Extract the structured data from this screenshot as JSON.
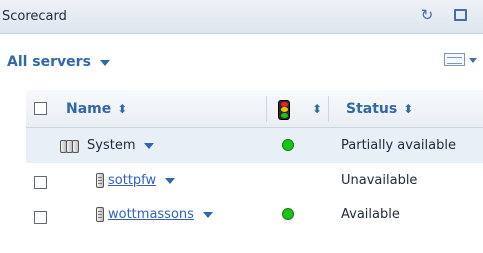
{
  "panel": {
    "title": "Scorecard",
    "icons": [
      "refresh-icon",
      "maximize-icon"
    ]
  },
  "scope": {
    "label": "All servers"
  },
  "table": {
    "columns": {
      "name": "Name",
      "health_icon": "traffic-light-icon",
      "status": "Status"
    },
    "rows": [
      {
        "name": "System",
        "type": "system",
        "has_checkbox": false,
        "health": "green",
        "status": "Partially available"
      },
      {
        "name": "sottpfw",
        "type": "server",
        "has_checkbox": true,
        "health": "",
        "status": "Unavailable"
      },
      {
        "name": "wottmassons",
        "type": "server",
        "has_checkbox": true,
        "health": "green",
        "status": "Available"
      }
    ]
  },
  "colors": {
    "accent": "#3068a8",
    "link": "#3060c0",
    "health_green": "#19c319",
    "selected_row": "#e8eff7"
  }
}
